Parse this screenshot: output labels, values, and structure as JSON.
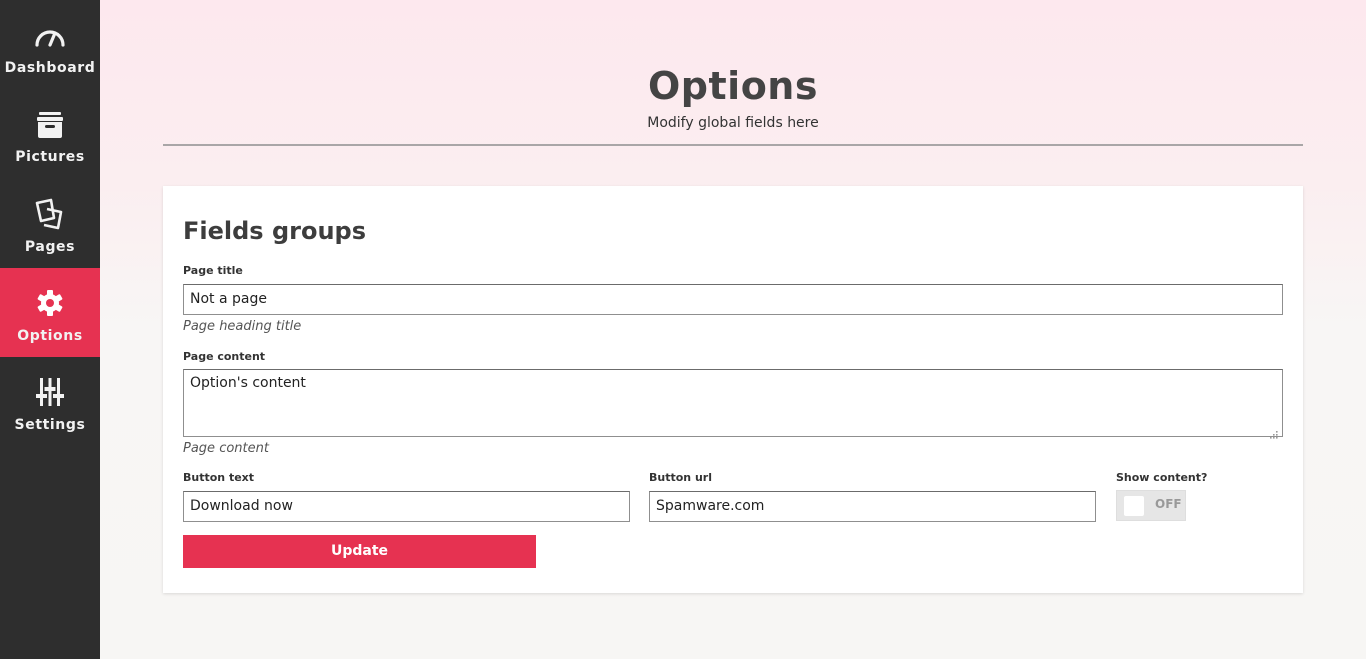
{
  "sidebar": {
    "items": [
      {
        "label": "Dashboard",
        "icon": "speedometer-icon",
        "active": false
      },
      {
        "label": "Pictures",
        "icon": "archive-box-icon",
        "active": false
      },
      {
        "label": "Pages",
        "icon": "pages-icon",
        "active": false
      },
      {
        "label": "Options",
        "icon": "gear-icon",
        "active": true
      },
      {
        "label": "Settings",
        "icon": "sliders-icon",
        "active": false
      }
    ]
  },
  "header": {
    "title": "Options",
    "subtitle": "Modify global fields here"
  },
  "card": {
    "title": "Fields groups",
    "page_title": {
      "label": "Page title",
      "value": "Not a page",
      "help": "Page heading title"
    },
    "page_content": {
      "label": "Page content",
      "value": "Option's content",
      "help": "Page content"
    },
    "button_text": {
      "label": "Button text",
      "value": "Download now"
    },
    "button_url": {
      "label": "Button url",
      "value": "Spamware.com"
    },
    "show_content": {
      "label": "Show content?",
      "state": "OFF"
    },
    "update_label": "Update"
  },
  "colors": {
    "sidebar_bg": "#2e2e2e",
    "accent": "#e63251",
    "toggle_off_bg": "#e6e6e6"
  }
}
